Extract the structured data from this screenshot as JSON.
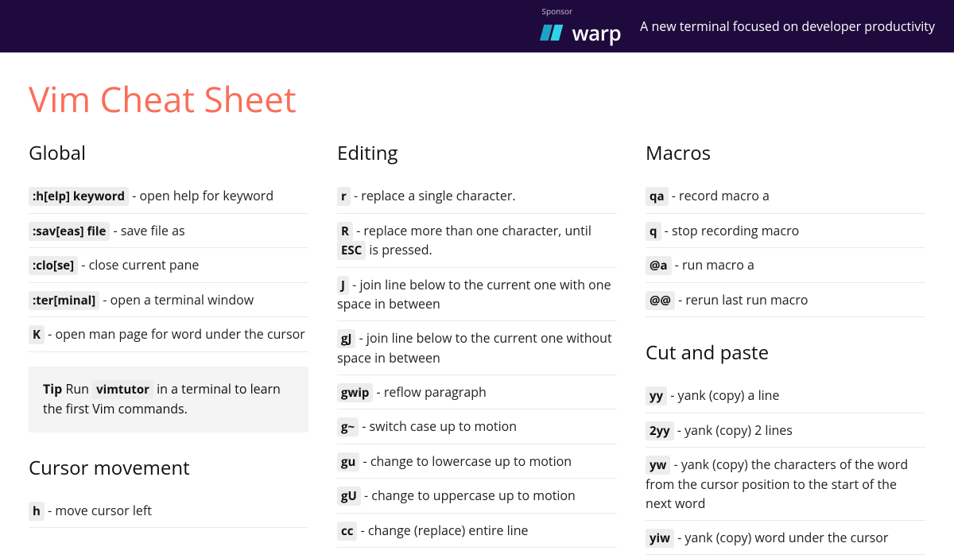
{
  "sponsor": {
    "label": "Sponsor",
    "brand": "warp",
    "tagline": "A new terminal focused on developer productivity"
  },
  "title": "Vim Cheat Sheet",
  "columns": [
    {
      "sections": [
        {
          "title": "Global",
          "items": [
            {
              "key": ":h[elp] keyword",
              "desc": "open help for keyword"
            },
            {
              "key": ":sav[eas] file",
              "desc": "save file as"
            },
            {
              "key": ":clo[se]",
              "desc": "close current pane"
            },
            {
              "key": ":ter[minal]",
              "desc": "open a terminal window"
            },
            {
              "key": "K",
              "desc": "open man page for word under the cursor"
            }
          ],
          "tip": {
            "label": "Tip",
            "pre": "Run",
            "cmd": "vimtutor",
            "post": "in a terminal to learn the first Vim commands."
          }
        },
        {
          "title": "Cursor movement",
          "items": [
            {
              "key": "h",
              "desc": "move cursor left"
            }
          ]
        }
      ]
    },
    {
      "sections": [
        {
          "title": "Editing",
          "items": [
            {
              "key": "r",
              "desc": "replace a single character."
            },
            {
              "key": "R",
              "desc_pre": "replace more than one character, until",
              "key2": "ESC",
              "desc_post": "is pressed."
            },
            {
              "key": "J",
              "desc": "join line below to the current one with one space in between"
            },
            {
              "key": "gJ",
              "desc": "join line below to the current one without space in between"
            },
            {
              "key": "gwip",
              "desc": "reflow paragraph"
            },
            {
              "key": "g~",
              "desc": "switch case up to motion"
            },
            {
              "key": "gu",
              "desc": "change to lowercase up to motion"
            },
            {
              "key": "gU",
              "desc": "change to uppercase up to motion"
            },
            {
              "key": "cc",
              "desc": "change (replace) entire line"
            }
          ]
        }
      ]
    },
    {
      "sections": [
        {
          "title": "Macros",
          "items": [
            {
              "key": "qa",
              "desc": "record macro a"
            },
            {
              "key": "q",
              "desc": "stop recording macro"
            },
            {
              "key": "@a",
              "desc": "run macro a"
            },
            {
              "key": "@@",
              "desc": "rerun last run macro"
            }
          ]
        },
        {
          "title": "Cut and paste",
          "items": [
            {
              "key": "yy",
              "desc": "yank (copy) a line"
            },
            {
              "key": "2yy",
              "desc": "yank (copy) 2 lines"
            },
            {
              "key": "yw",
              "desc": "yank (copy) the characters of the word from the cursor position to the start of the next word"
            },
            {
              "key": "yiw",
              "desc": "yank (copy) word under the cursor"
            }
          ]
        }
      ]
    }
  ]
}
